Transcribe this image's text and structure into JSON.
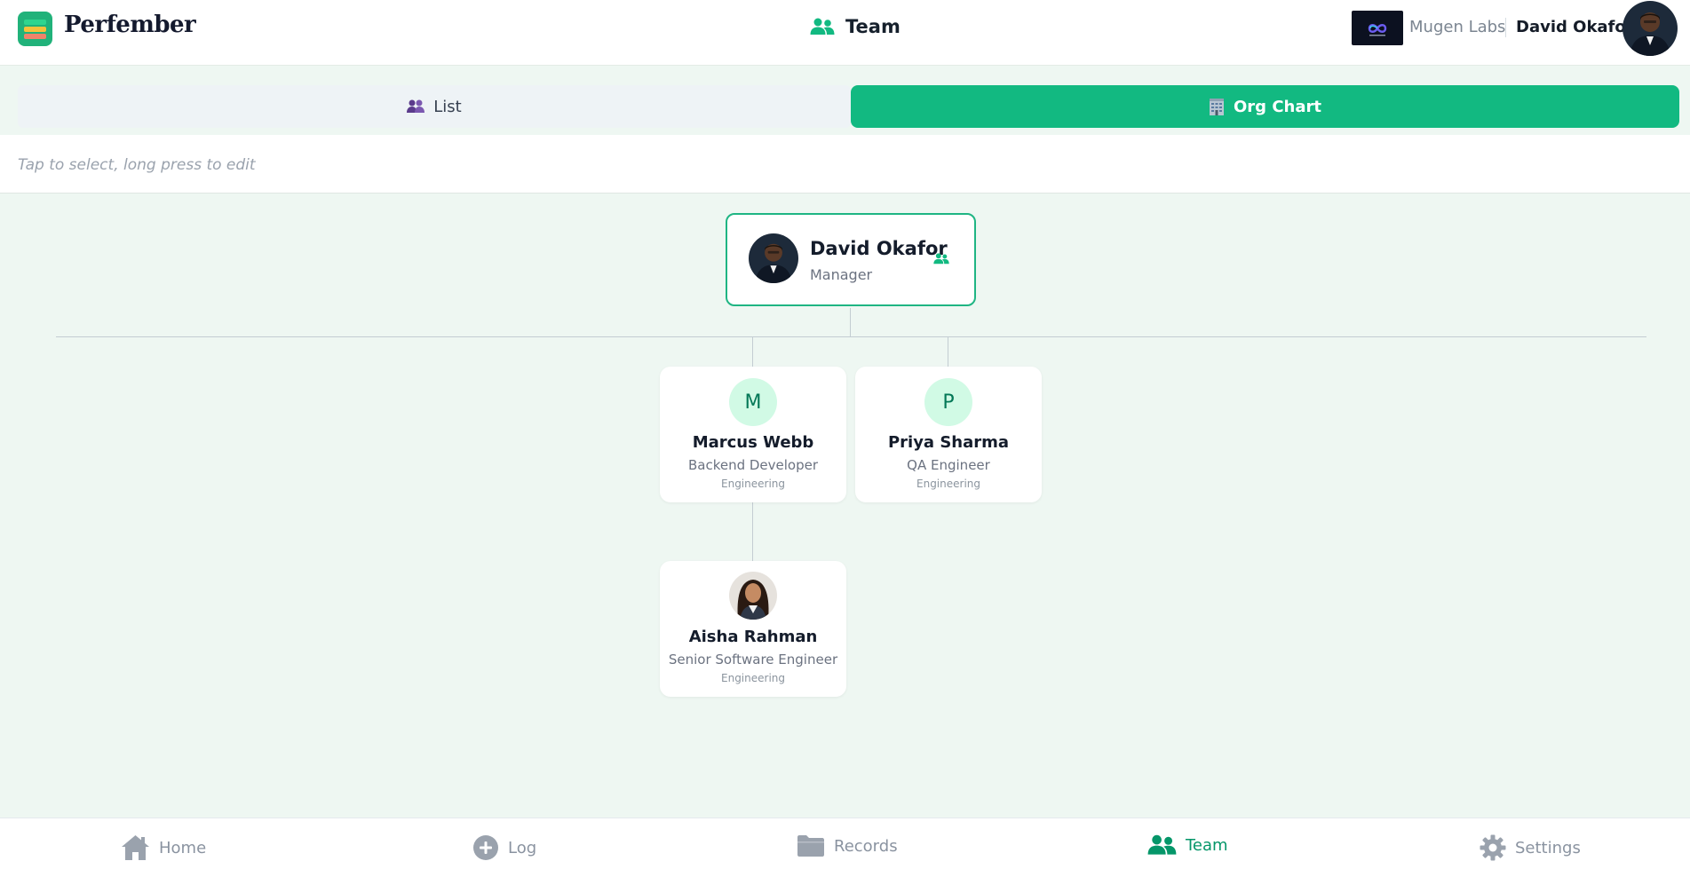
{
  "header": {
    "brand": "Perfember",
    "title": "Team",
    "org_name": "Mugen Labs",
    "user_name": "David Okafor"
  },
  "view_toggle": {
    "list_label": "List",
    "org_chart_label": "Org Chart",
    "active": "org_chart"
  },
  "hint": "Tap to select, long press to edit",
  "org_chart": {
    "root": {
      "name": "David Okafor",
      "role": "Manager"
    },
    "reports": [
      {
        "initial": "M",
        "name": "Marcus Webb",
        "role": "Backend Developer",
        "department": "Engineering"
      },
      {
        "initial": "P",
        "name": "Priya Sharma",
        "role": "QA Engineer",
        "department": "Engineering"
      }
    ],
    "sub_reports": [
      {
        "name": "Aisha Rahman",
        "role": "Senior Software Engineer",
        "department": "Engineering",
        "manager": "Marcus Webb"
      }
    ]
  },
  "bottom_nav": {
    "items": [
      {
        "label": "Home",
        "icon": "home-icon"
      },
      {
        "label": "Log",
        "icon": "plus-circle-icon"
      },
      {
        "label": "Records",
        "icon": "folder-icon"
      },
      {
        "label": "Team",
        "icon": "team-icon"
      },
      {
        "label": "Settings",
        "icon": "gear-icon"
      }
    ],
    "active": "Team"
  },
  "colors": {
    "accent": "#12b981",
    "accent_dark": "#059669",
    "background": "#eef7f2",
    "initial_bg": "#d1fae5"
  }
}
